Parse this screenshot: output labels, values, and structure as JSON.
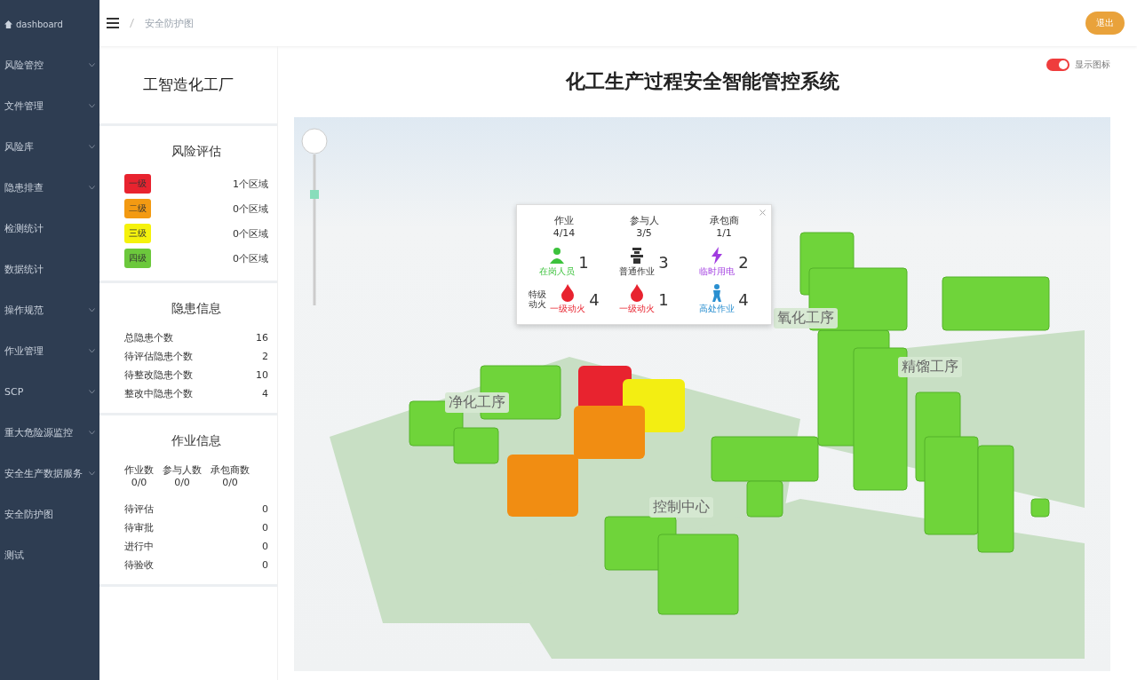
{
  "sidebar": {
    "items": [
      {
        "label": "dashboard",
        "kind": "home",
        "expandable": false
      },
      {
        "label": "风险管控",
        "kind": "menu",
        "expandable": true
      },
      {
        "label": "文件管理",
        "kind": "menu",
        "expandable": true
      },
      {
        "label": "风险库",
        "kind": "menu",
        "expandable": true
      },
      {
        "label": "隐患排查",
        "kind": "menu",
        "expandable": true
      },
      {
        "label": "检测统计",
        "kind": "menu",
        "expandable": false
      },
      {
        "label": "数据统计",
        "kind": "menu",
        "expandable": false
      },
      {
        "label": "操作规范",
        "kind": "menu",
        "expandable": true
      },
      {
        "label": "作业管理",
        "kind": "menu",
        "expandable": true
      },
      {
        "label": "SCP",
        "kind": "menu",
        "expandable": true
      },
      {
        "label": "重大危险源监控",
        "kind": "menu",
        "expandable": true
      },
      {
        "label": "安全生产数据服务",
        "kind": "menu",
        "expandable": true
      },
      {
        "label": "安全防护图",
        "kind": "menu",
        "expandable": false
      },
      {
        "label": "测试",
        "kind": "menu",
        "expandable": false
      }
    ]
  },
  "header": {
    "breadcrumb": "安全防护图",
    "logout": "退出"
  },
  "factory": {
    "name": "工智造化工厂"
  },
  "risk": {
    "title": "风险评估",
    "levels": [
      {
        "label": "一级",
        "count": "1个区域",
        "color": "#e8232f"
      },
      {
        "label": "二级",
        "count": "0个区域",
        "color": "#f39a12"
      },
      {
        "label": "三级",
        "count": "0个区域",
        "color": "#f5f20c"
      },
      {
        "label": "四级",
        "count": "0个区域",
        "color": "#6cc83c"
      }
    ]
  },
  "hazards": {
    "title": "隐患信息",
    "rows": [
      {
        "label": "总隐患个数",
        "value": "16"
      },
      {
        "label": "待评估隐患个数",
        "value": "2"
      },
      {
        "label": "待整改隐患个数",
        "value": "10"
      },
      {
        "label": "整改中隐患个数",
        "value": "4"
      }
    ]
  },
  "work": {
    "title": "作业信息",
    "stats": [
      {
        "label": "作业数",
        "value": "0/0"
      },
      {
        "label": "参与人数",
        "value": "0/0"
      },
      {
        "label": "承包商数",
        "value": "0/0"
      }
    ],
    "rows": [
      {
        "label": "待评估",
        "value": "0"
      },
      {
        "label": "待审批",
        "value": "0"
      },
      {
        "label": "进行中",
        "value": "0"
      },
      {
        "label": "待验收",
        "value": "0"
      }
    ]
  },
  "main": {
    "title": "化工生产过程安全智能管控系统",
    "toggle": {
      "label": "显示图标",
      "on": true
    }
  },
  "map": {
    "labels": [
      {
        "text": "氧化工序",
        "kind": "a"
      },
      {
        "text": "精馏工序",
        "kind": "b"
      },
      {
        "text": "净化工序",
        "kind": "c"
      },
      {
        "text": "控制中心",
        "kind": "d"
      }
    ],
    "popup": {
      "stats": [
        {
          "label": "作业",
          "value": "4/14"
        },
        {
          "label": "参与人",
          "value": "3/5"
        },
        {
          "label": "承包商",
          "value": "1/1"
        }
      ],
      "items": [
        {
          "kind": "person",
          "caption": "在岗人员",
          "count": "1",
          "color": "#3cc23c"
        },
        {
          "kind": "tower",
          "caption": "普通作业",
          "count": "3",
          "color": "#333333"
        },
        {
          "kind": "bolt",
          "caption": "临时用电",
          "count": "2",
          "color": "#a13ce0"
        },
        {
          "kind": "fire-special",
          "caption": "一级动火",
          "count": "4",
          "color": "#e8232f",
          "side": "特级动火"
        },
        {
          "kind": "fire",
          "caption": "一级动火",
          "count": "1",
          "color": "#e8232f"
        },
        {
          "kind": "climber",
          "caption": "高处作业",
          "count": "4",
          "color": "#2a8fd0"
        }
      ]
    }
  }
}
